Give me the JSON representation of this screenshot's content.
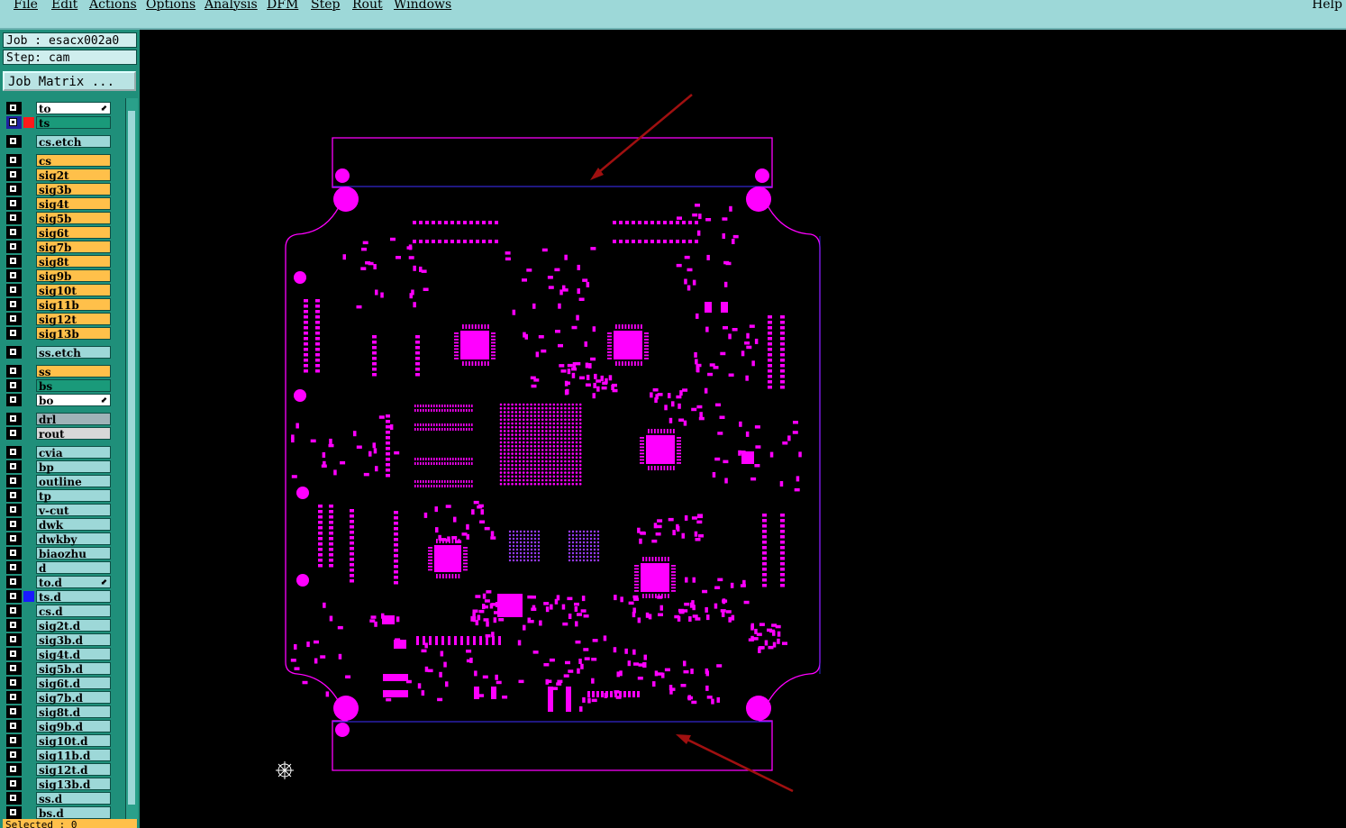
{
  "menu": {
    "items": [
      "File",
      "Edit",
      "Actions",
      "Options",
      "Analysis",
      "DFM",
      "Step",
      "Rout",
      "Windows"
    ],
    "help": "Help"
  },
  "job": {
    "job_label": "Job : esacx002a0",
    "step_label": "Step: cam",
    "matrix_button": "Job Matrix ..."
  },
  "layers": [
    {
      "name": "to",
      "color": "#ffffff",
      "mark": "⬋",
      "group": 1
    },
    {
      "name": "ts",
      "color": "#1a9a7a",
      "swatch": "#ff1a1a",
      "group": 1,
      "active": true
    },
    {
      "name": "cs.etch",
      "color": "#9dd8d8",
      "group": 2
    },
    {
      "name": "cs",
      "color": "#ffc04a",
      "group": 3
    },
    {
      "name": "sig2t",
      "color": "#ffc04a",
      "group": 3
    },
    {
      "name": "sig3b",
      "color": "#ffc04a",
      "group": 3
    },
    {
      "name": "sig4t",
      "color": "#ffc04a",
      "group": 3
    },
    {
      "name": "sig5b",
      "color": "#ffc04a",
      "group": 3
    },
    {
      "name": "sig6t",
      "color": "#ffc04a",
      "group": 3
    },
    {
      "name": "sig7b",
      "color": "#ffc04a",
      "group": 3
    },
    {
      "name": "sig8t",
      "color": "#ffc04a",
      "group": 3
    },
    {
      "name": "sig9b",
      "color": "#ffc04a",
      "group": 3
    },
    {
      "name": "sig10t",
      "color": "#ffc04a",
      "group": 3
    },
    {
      "name": "sig11b",
      "color": "#ffc04a",
      "group": 3
    },
    {
      "name": "sig12t",
      "color": "#ffc04a",
      "group": 3
    },
    {
      "name": "sig13b",
      "color": "#ffc04a",
      "group": 3
    },
    {
      "name": "ss.etch",
      "color": "#9dd8d8",
      "group": 4
    },
    {
      "name": "ss",
      "color": "#ffc04a",
      "group": 5
    },
    {
      "name": "bs",
      "color": "#1a9a7a",
      "group": 5
    },
    {
      "name": "bo",
      "color": "#ffffff",
      "mark": "⬋",
      "group": 5
    },
    {
      "name": "drl",
      "color": "#9fb3b8",
      "group": 6
    },
    {
      "name": "rout",
      "color": "#d8d8d8",
      "group": 6
    },
    {
      "name": "cvia",
      "color": "#9dd8d8",
      "group": 7
    },
    {
      "name": "bp",
      "color": "#9dd8d8",
      "group": 7
    },
    {
      "name": "outline",
      "color": "#9dd8d8",
      "group": 7
    },
    {
      "name": "tp",
      "color": "#9dd8d8",
      "group": 7
    },
    {
      "name": "v-cut",
      "color": "#9dd8d8",
      "group": 7
    },
    {
      "name": "dwk",
      "color": "#9dd8d8",
      "group": 7
    },
    {
      "name": "dwkby",
      "color": "#9dd8d8",
      "group": 7
    },
    {
      "name": "biaozhu",
      "color": "#9dd8d8",
      "group": 7
    },
    {
      "name": "d",
      "color": "#9dd8d8",
      "group": 7
    },
    {
      "name": "to.d",
      "color": "#9dd8d8",
      "mark": "⬋",
      "group": 7
    },
    {
      "name": "ts.d",
      "color": "#9dd8d8",
      "swatch": "#1a1aff",
      "group": 7
    },
    {
      "name": "cs.d",
      "color": "#9dd8d8",
      "group": 7
    },
    {
      "name": "sig2t.d",
      "color": "#9dd8d8",
      "group": 7
    },
    {
      "name": "sig3b.d",
      "color": "#9dd8d8",
      "group": 7
    },
    {
      "name": "sig4t.d",
      "color": "#9dd8d8",
      "group": 7
    },
    {
      "name": "sig5b.d",
      "color": "#9dd8d8",
      "group": 7
    },
    {
      "name": "sig6t.d",
      "color": "#9dd8d8",
      "group": 7
    },
    {
      "name": "sig7b.d",
      "color": "#9dd8d8",
      "group": 7
    },
    {
      "name": "sig8t.d",
      "color": "#9dd8d8",
      "group": 7
    },
    {
      "name": "sig9b.d",
      "color": "#9dd8d8",
      "group": 7
    },
    {
      "name": "sig10t.d",
      "color": "#9dd8d8",
      "group": 7
    },
    {
      "name": "sig11b.d",
      "color": "#9dd8d8",
      "group": 7
    },
    {
      "name": "sig12t.d",
      "color": "#9dd8d8",
      "group": 7
    },
    {
      "name": "sig13b.d",
      "color": "#9dd8d8",
      "group": 7
    },
    {
      "name": "ss.d",
      "color": "#9dd8d8",
      "group": 7
    },
    {
      "name": "bs.d",
      "color": "#9dd8d8",
      "group": 7
    }
  ],
  "status": {
    "selected": "Selected : 0"
  },
  "colors": {
    "board": "#ff00ff",
    "outline_blue": "#4030ff",
    "arrow": "#a01010",
    "menubar": "#9dd8d8",
    "panel": "#1f8f7a"
  }
}
